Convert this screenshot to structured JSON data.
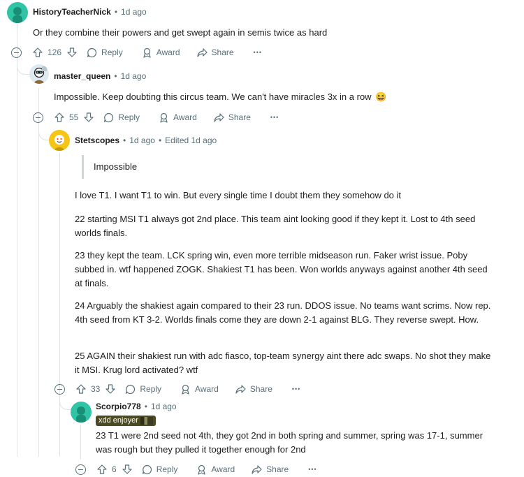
{
  "comments": [
    {
      "author": "HistoryTeacherNick",
      "time": "1d ago",
      "body": "Or they combine their powers and get swept again in semis twice as hard",
      "votes": "126",
      "reply_label": "Reply",
      "award_label": "Award",
      "share_label": "Share",
      "more_label": "•••"
    },
    {
      "author": "master_queen",
      "time": "1d ago",
      "body": "Impossible. Keep doubting this circus team. We can't have miracles 3x in a row",
      "emoji": "😆",
      "votes": "55",
      "reply_label": "Reply",
      "award_label": "Award",
      "share_label": "Share",
      "more_label": "•••"
    },
    {
      "author": "Stetscopes",
      "time": "1d ago",
      "edited": "Edited 1d ago",
      "quote": "Impossible",
      "paragraphs": [
        "I love T1. I want T1 to win. But every single time I doubt them they somehow do it",
        "22 starting MSI T1 always got 2nd place. This team aint looking good if they kept it. Lost to 4th seed worlds finals.",
        "23 they kept the team. LCK spring win, even more terrible midseason run. Faker wrist issue. Poby subbed in. wtf happened ZOGK. Shakiest T1 has been. Won worlds anyways against another 4th seed at finals.",
        "24 Arguably the shakiest again compared to their 23 run. DDOS issue. No teams want scrims. Now rep. 4th seed from KT 3-2. Worlds finals come they are down 2-1 against BLG. They reverse swept. How.",
        "25 AGAIN their shakiest run with adc fiasco, top-team synergy aint there adc swaps. No shot they make it MSI. Krug lord activated? wtf"
      ],
      "votes": "33",
      "reply_label": "Reply",
      "award_label": "Award",
      "share_label": "Share",
      "more_label": "•••"
    },
    {
      "author": "Scorpio778",
      "time": "1d ago",
      "flair": "xdd enjoyer",
      "body": "23 T1 were 2nd seed not 4th, they got 2nd in both spring and summer, spring was 17-1, summer was rough but they pulled it together enough for 2nd",
      "votes": "6",
      "reply_label": "Reply",
      "award_label": "Award",
      "share_label": "Share",
      "more_label": "•••"
    }
  ],
  "colors": {
    "text": "#1c1c1c",
    "meta": "#576f76",
    "thread_line": "#dfe3e6",
    "avatar_teal": "#2ec4a5",
    "avatar_yellow": "#f5c518",
    "flair_bg": "#4b4a22"
  },
  "icons": {
    "upvote": "upvote-arrow-icon",
    "downvote": "downvote-arrow-icon",
    "reply": "speech-bubble-icon",
    "award": "award-ribbon-icon",
    "share": "share-arrow-icon",
    "collapse": "collapse-minus-icon",
    "more": "ellipsis-icon"
  }
}
